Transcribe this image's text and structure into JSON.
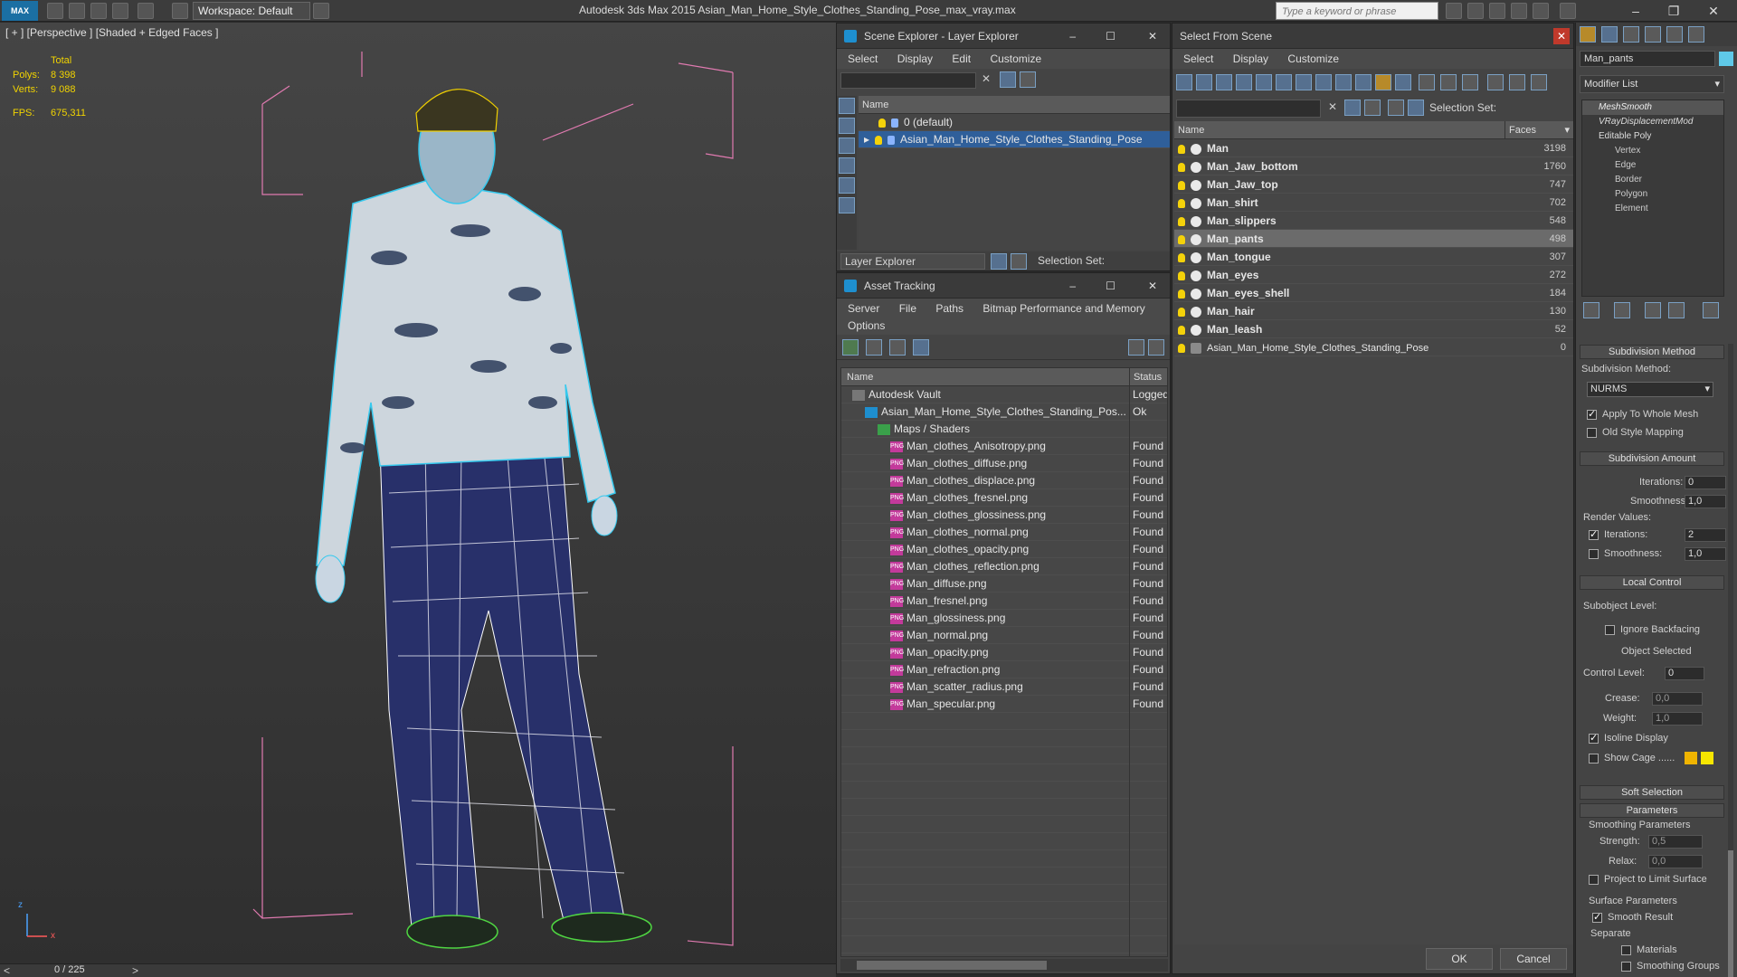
{
  "app": {
    "logo_text": "MAX",
    "workspace": "Workspace: Default",
    "title": "Autodesk 3ds Max  2015     Asian_Man_Home_Style_Clothes_Standing_Pose_max_vray.max",
    "search_placeholder": "Type a keyword or phrase"
  },
  "viewport": {
    "label": "[ + ] [Perspective ] [Shaded + Edged Faces ]",
    "stats": {
      "total_label": "Total",
      "polys_label": "Polys:",
      "polys_value": "8 398",
      "verts_label": "Verts:",
      "verts_value": "9 088",
      "fps_label": "FPS:",
      "fps_value": "675,311"
    },
    "axis_z": "z",
    "axis_x": "x",
    "timeline": "0 / 225"
  },
  "scene_explorer": {
    "title": "Scene Explorer - Layer Explorer",
    "menu": [
      "Select",
      "Display",
      "Edit",
      "Customize"
    ],
    "col_name": "Name",
    "rows": [
      "0 (default)",
      "Asian_Man_Home_Style_Clothes_Standing_Pose"
    ],
    "footer_mode": "Layer Explorer",
    "footer_sel": "Selection Set:"
  },
  "asset_tracking": {
    "title": "Asset Tracking",
    "menu1": [
      "Server",
      "File",
      "Paths",
      "Bitmap Performance and Memory"
    ],
    "menu2": [
      "Options"
    ],
    "col_name": "Name",
    "col_status": "Status",
    "rows": [
      {
        "name": "Autodesk Vault",
        "status": "Logged",
        "indent": 0,
        "icon": "vault"
      },
      {
        "name": "Asian_Man_Home_Style_Clothes_Standing_Pos...",
        "status": "Ok",
        "indent": 1,
        "icon": "max"
      },
      {
        "name": "Maps / Shaders",
        "status": "",
        "indent": 2,
        "icon": "maps"
      },
      {
        "name": "Man_clothes_Anisotropy.png",
        "status": "Found",
        "indent": 3,
        "icon": "png"
      },
      {
        "name": "Man_clothes_diffuse.png",
        "status": "Found",
        "indent": 3,
        "icon": "png"
      },
      {
        "name": "Man_clothes_displace.png",
        "status": "Found",
        "indent": 3,
        "icon": "png"
      },
      {
        "name": "Man_clothes_fresnel.png",
        "status": "Found",
        "indent": 3,
        "icon": "png"
      },
      {
        "name": "Man_clothes_glossiness.png",
        "status": "Found",
        "indent": 3,
        "icon": "png"
      },
      {
        "name": "Man_clothes_normal.png",
        "status": "Found",
        "indent": 3,
        "icon": "png"
      },
      {
        "name": "Man_clothes_opacity.png",
        "status": "Found",
        "indent": 3,
        "icon": "png"
      },
      {
        "name": "Man_clothes_reflection.png",
        "status": "Found",
        "indent": 3,
        "icon": "png"
      },
      {
        "name": "Man_diffuse.png",
        "status": "Found",
        "indent": 3,
        "icon": "png"
      },
      {
        "name": "Man_fresnel.png",
        "status": "Found",
        "indent": 3,
        "icon": "png"
      },
      {
        "name": "Man_glossiness.png",
        "status": "Found",
        "indent": 3,
        "icon": "png"
      },
      {
        "name": "Man_normal.png",
        "status": "Found",
        "indent": 3,
        "icon": "png"
      },
      {
        "name": "Man_opacity.png",
        "status": "Found",
        "indent": 3,
        "icon": "png"
      },
      {
        "name": "Man_refraction.png",
        "status": "Found",
        "indent": 3,
        "icon": "png"
      },
      {
        "name": "Man_scatter_radius.png",
        "status": "Found",
        "indent": 3,
        "icon": "png"
      },
      {
        "name": "Man_specular.png",
        "status": "Found",
        "indent": 3,
        "icon": "png"
      }
    ],
    "png_badge": "PNG"
  },
  "select_from_scene": {
    "title": "Select From Scene",
    "menu": [
      "Select",
      "Display",
      "Customize"
    ],
    "selection_set": "Selection Set:",
    "col_name": "Name",
    "col_faces": "Faces",
    "rows": [
      {
        "name": "Man",
        "faces": "3198",
        "selected": false
      },
      {
        "name": "Man_Jaw_bottom",
        "faces": "1760",
        "selected": false
      },
      {
        "name": "Man_Jaw_top",
        "faces": "747",
        "selected": false
      },
      {
        "name": "Man_shirt",
        "faces": "702",
        "selected": false
      },
      {
        "name": "Man_slippers",
        "faces": "548",
        "selected": false
      },
      {
        "name": "Man_pants",
        "faces": "498",
        "selected": true
      },
      {
        "name": "Man_tongue",
        "faces": "307",
        "selected": false
      },
      {
        "name": "Man_eyes",
        "faces": "272",
        "selected": false
      },
      {
        "name": "Man_eyes_shell",
        "faces": "184",
        "selected": false
      },
      {
        "name": "Man_hair",
        "faces": "130",
        "selected": false
      },
      {
        "name": "Man_leash",
        "faces": "52",
        "selected": false
      },
      {
        "name": "Asian_Man_Home_Style_Clothes_Standing_Pose",
        "faces": "0",
        "selected": false
      }
    ],
    "ok": "OK",
    "cancel": "Cancel"
  },
  "command_panel": {
    "object_name": "Man_pants",
    "modifier_list": "Modifier List",
    "stack": [
      "MeshSmooth",
      "VRayDisplacementMod",
      "Editable Poly",
      "Vertex",
      "Edge",
      "Border",
      "Polygon",
      "Element"
    ],
    "subdivision_method_hdr": "Subdivision Method",
    "subdivision_method_label": "Subdivision Method:",
    "subdivision_method_value": "NURMS",
    "apply_whole_mesh": "Apply To Whole Mesh",
    "old_style_mapping": "Old Style Mapping",
    "subdivision_amount_hdr": "Subdivision Amount",
    "iterations_label": "Iterations:",
    "iterations_value": "0",
    "smoothness_label": "Smoothness:",
    "smoothness_value": "1,0",
    "render_values_label": "Render Values:",
    "render_iterations_value": "2",
    "render_smoothness_value": "1,0",
    "local_control_hdr": "Local Control",
    "subobject_level": "Subobject Level:",
    "ignore_backfacing": "Ignore Backfacing",
    "object_selected": "Object Selected",
    "control_level_label": "Control Level:",
    "control_level_value": "0",
    "crease_label": "Crease:",
    "crease_value": "0,0",
    "weight_label": "Weight:",
    "weight_value": "1,0",
    "isoline_display": "Isoline Display",
    "show_cage": "Show Cage ......",
    "soft_selection_hdr": "Soft Selection",
    "parameters_hdr": "Parameters",
    "smoothing_parameters": "Smoothing Parameters",
    "strength_label": "Strength:",
    "strength_value": "0,5",
    "relax_label": "Relax:",
    "relax_value": "0,0",
    "project_limit": "Project to Limit Surface",
    "surface_parameters": "Surface Parameters",
    "smooth_result": "Smooth Result",
    "separate_label": "Separate",
    "materials": "Materials",
    "smoothing_groups": "Smoothing Groups",
    "cage_color_1": "#f0b400",
    "cage_color_2": "#f7e600"
  }
}
